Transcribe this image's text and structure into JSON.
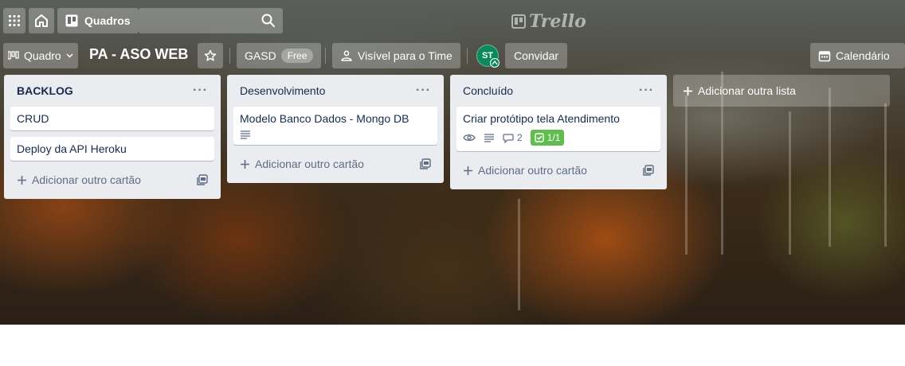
{
  "header": {
    "apps_icon": "grid-icon",
    "home_icon": "home-icon",
    "boards_label": "Quadros",
    "search_value": "",
    "search_placeholder": "",
    "logo_text": "Trello"
  },
  "board": {
    "view_label": "Quadro",
    "title": "PA - ASO WEB",
    "workspace_label": "GASD",
    "plan_badge": "Free",
    "visibility_label": "Visível para o Time",
    "member_initials": "ST",
    "invite_label": "Convidar",
    "calendar_label": "Calendário"
  },
  "lists": [
    {
      "title": "BACKLOG",
      "menu": "···",
      "cards": [
        {
          "title": "CRUD"
        },
        {
          "title": "Deploy da API Heroku"
        }
      ],
      "add_card_label": "Adicionar outro cartão"
    },
    {
      "title": "Desenvolvimento",
      "menu": "···",
      "cards": [
        {
          "title": "Modelo Banco Dados - Mongo DB",
          "has_description": true
        }
      ],
      "add_card_label": "Adicionar outro cartão"
    },
    {
      "title": "Concluído",
      "menu": "···",
      "cards": [
        {
          "title": "Criar protótipo tela Atendimento",
          "watching": true,
          "has_description": true,
          "comments": "2",
          "checklist": "1/1"
        }
      ],
      "add_card_label": "Adicionar outro cartão"
    }
  ],
  "add_list_label": "Adicionar outra lista",
  "colors": {
    "list_bg": "#ebecf0",
    "checklist_complete": "#61bd4f",
    "avatar": "#0a8a5c"
  }
}
